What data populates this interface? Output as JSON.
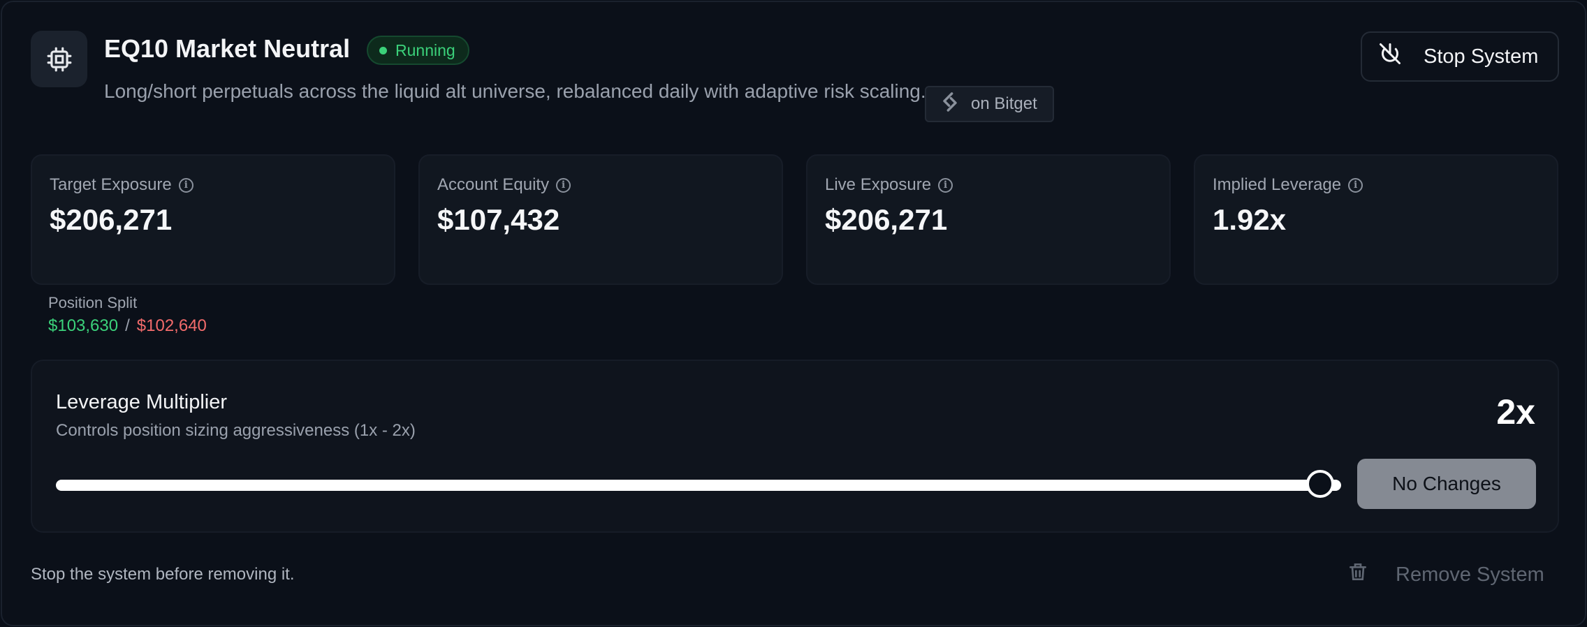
{
  "header": {
    "icon": "chip-icon",
    "title": "EQ10 Market Neutral",
    "status": "Running",
    "subtitle": "Long/short perpetuals across the liquid alt universe, rebalanced daily with adaptive risk scaling.",
    "exchange_label": "on Bitget",
    "stop_button": "Stop System"
  },
  "stats": [
    {
      "label": "Target Exposure",
      "value": "$206,271"
    },
    {
      "label": "Account Equity",
      "value": "$107,432"
    },
    {
      "label": "Live Exposure",
      "value": "$206,271"
    },
    {
      "label": "Implied Leverage",
      "value": "1.92x"
    }
  ],
  "position_split": {
    "label": "Position Split",
    "long": "$103,630",
    "separator": "/",
    "short": "$102,640"
  },
  "leverage": {
    "title": "Leverage Multiplier",
    "description": "Controls position sizing aggressiveness (1x - 2x)",
    "value_label": "2x",
    "slider_level": 1.0,
    "apply_button": "No Changes"
  },
  "footer": {
    "note": "Stop the system before removing it.",
    "remove_button": "Remove System"
  },
  "colors": {
    "accent_green": "#3bd17a",
    "accent_red": "#f26b6b",
    "background": "#0b1019"
  }
}
